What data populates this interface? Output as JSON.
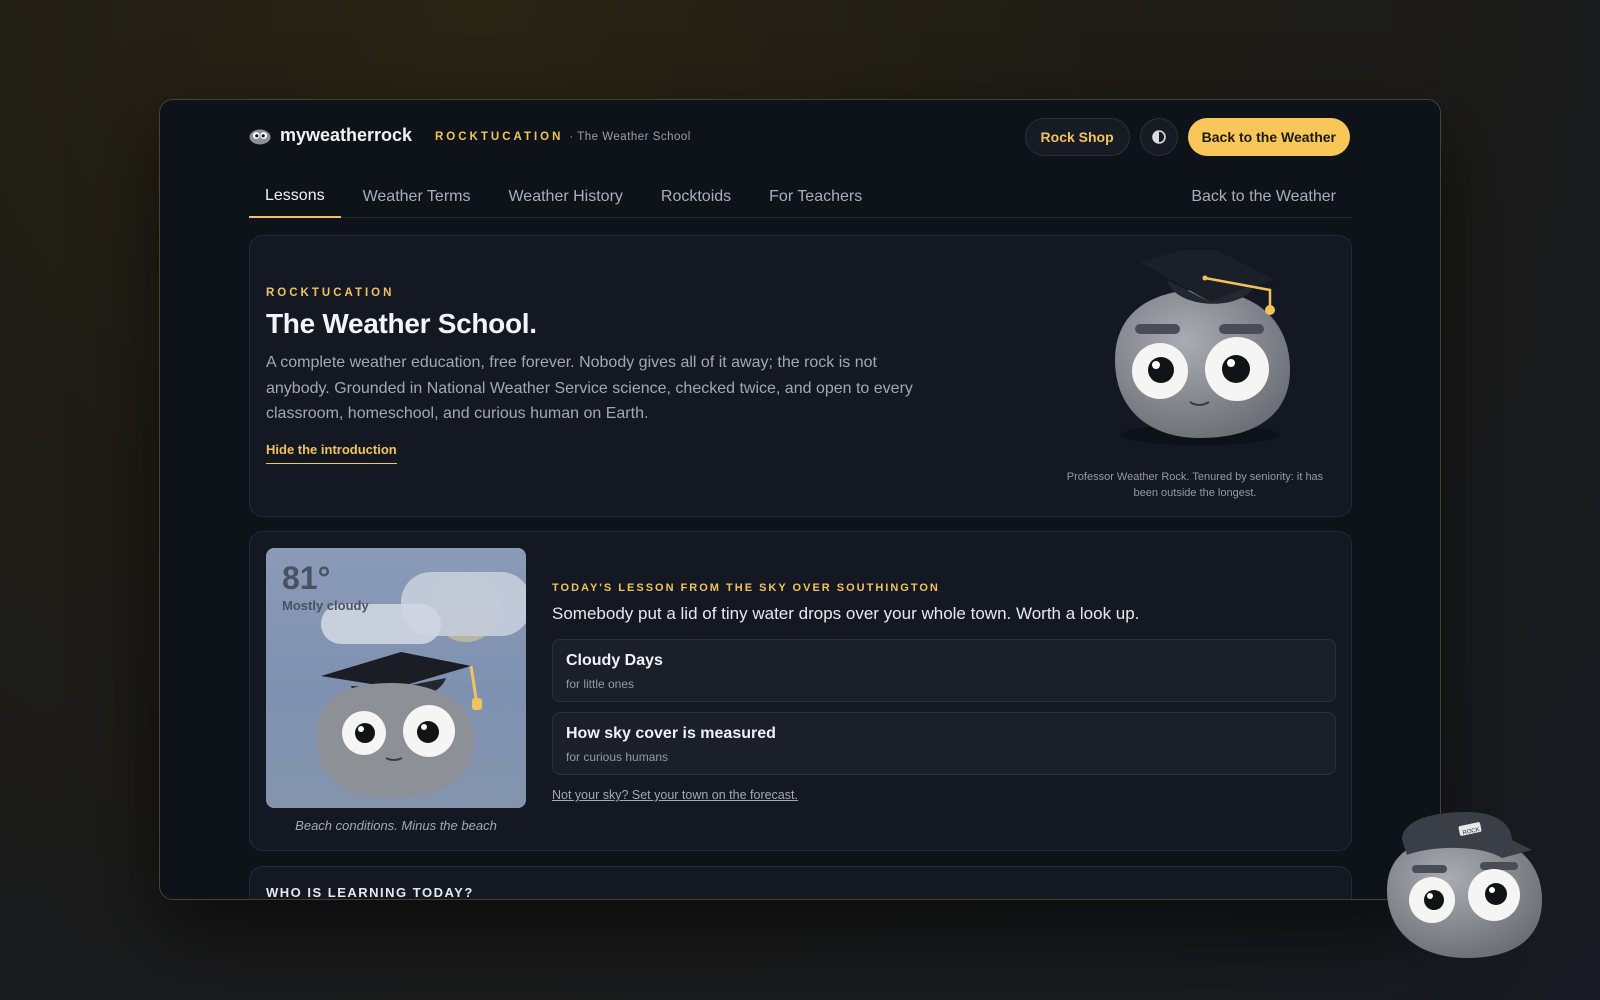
{
  "brand": {
    "name": "myweatherrock",
    "logo": "rock-eyes-icon"
  },
  "kicker": {
    "label": "ROCKTUCATION",
    "sub": "· The Weather School"
  },
  "actions": {
    "shop": "Rock Shop",
    "theme": "contrast-icon",
    "back": "Back to the Weather"
  },
  "tabs": [
    {
      "label": "Lessons",
      "active": true
    },
    {
      "label": "Weather Terms"
    },
    {
      "label": "Weather History"
    },
    {
      "label": "Rocktoids"
    },
    {
      "label": "For Teachers"
    }
  ],
  "tab_right": "Back to the Weather",
  "intro": {
    "eyebrow": "ROCKTUCATION",
    "title": "The Weather School.",
    "body": "A complete weather education, free forever. Nobody gives all of it away; the rock is not anybody. Grounded in National Weather Service science, checked twice, and open to every classroom, homeschool, and curious human on Earth.",
    "hide_link": "Hide the introduction",
    "caption": "Professor Weather Rock. Tenured by seniority: it has been outside the longest."
  },
  "lesson": {
    "temp": "81°",
    "condition": "Mostly cloudy",
    "image_caption": "Beach conditions. Minus the beach",
    "eyebrow": "TODAY'S LESSON FROM THE SKY OVER SOUTHINGTON",
    "title": "Somebody put a lid of tiny water drops over your whole town. Worth a look up.",
    "options": [
      {
        "title": "Cloudy Days",
        "sub": "for little ones"
      },
      {
        "title": "How sky cover is measured",
        "sub": "for curious humans"
      }
    ],
    "link": "Not your sky? Set your town on the forecast."
  },
  "who": {
    "title": "WHO IS LEARNING TODAY?"
  },
  "mascot": {
    "hat_text": "ROCK"
  },
  "colors": {
    "accent": "#f2c35c",
    "button": "#f8c659",
    "panel": "#131822",
    "window": "#0e1219"
  }
}
